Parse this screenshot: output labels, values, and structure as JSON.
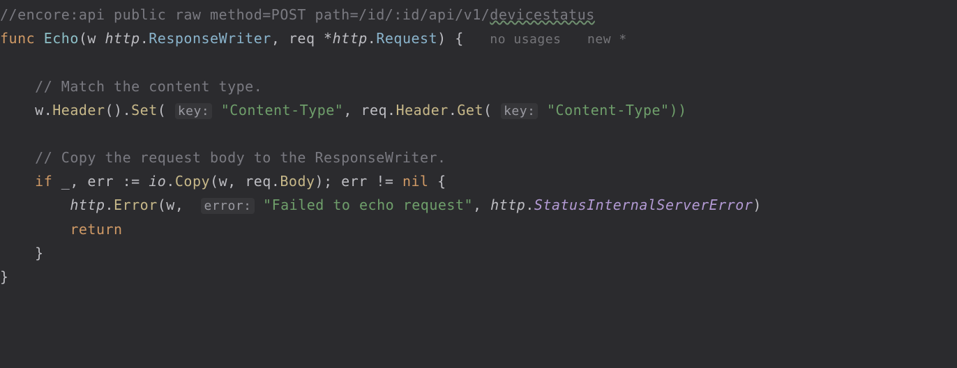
{
  "code": {
    "l1_comment_prefix": "//encore:api public raw method=POST path=/id/:id/api/v1/",
    "l1_comment_squiggle": "devicestatus",
    "l2_func": "func",
    "l2_name": "Echo",
    "l2_sig1": "(w ",
    "l2_http1": "http",
    "l2_dot1": ".",
    "l2_rw": "ResponseWriter",
    "l2_comma": ", req *",
    "l2_http2": "http",
    "l2_dot2": ".",
    "l2_req": "Request",
    "l2_close": ") {",
    "l2_usages": "no usages",
    "l2_new": "new *",
    "c1": "// Match the content type.",
    "l4_pre": "    w.",
    "l4_header": "Header",
    "l4_p1": "().",
    "l4_set": "Set",
    "l4_open": "( ",
    "l4_keyhint": "key:",
    "l4_str1": " \"Content-Type\"",
    "l4_mid": ", req.",
    "l4_header2": "Header",
    "l4_dot": ".",
    "l4_get": "Get",
    "l4_open2": "( ",
    "l4_keyhint2": "key:",
    "l4_str2": " \"Content-Type\"))",
    "c2": "// Copy the request body to the ResponseWriter.",
    "l6_if": "if",
    "l6_mid": " _, err := ",
    "l6_io": "io",
    "l6_dot": ".",
    "l6_copy": "Copy",
    "l6_args": "(w, req.",
    "l6_body": "Body",
    "l6_close": "); err != ",
    "l6_nil": "nil",
    "l6_brace": " {",
    "l7_pre": "        ",
    "l7_http": "http",
    "l7_dot": ".",
    "l7_error": "Error",
    "l7_open": "(w,  ",
    "l7_hint": "error:",
    "l7_str": " \"Failed to echo request\"",
    "l7_mid": ", ",
    "l7_http2": "http",
    "l7_dot2": ".",
    "l7_const": "StatusInternalServerError",
    "l7_close": ")",
    "l8_return": "return",
    "l9_brace": "    }",
    "l10_brace": "}"
  }
}
